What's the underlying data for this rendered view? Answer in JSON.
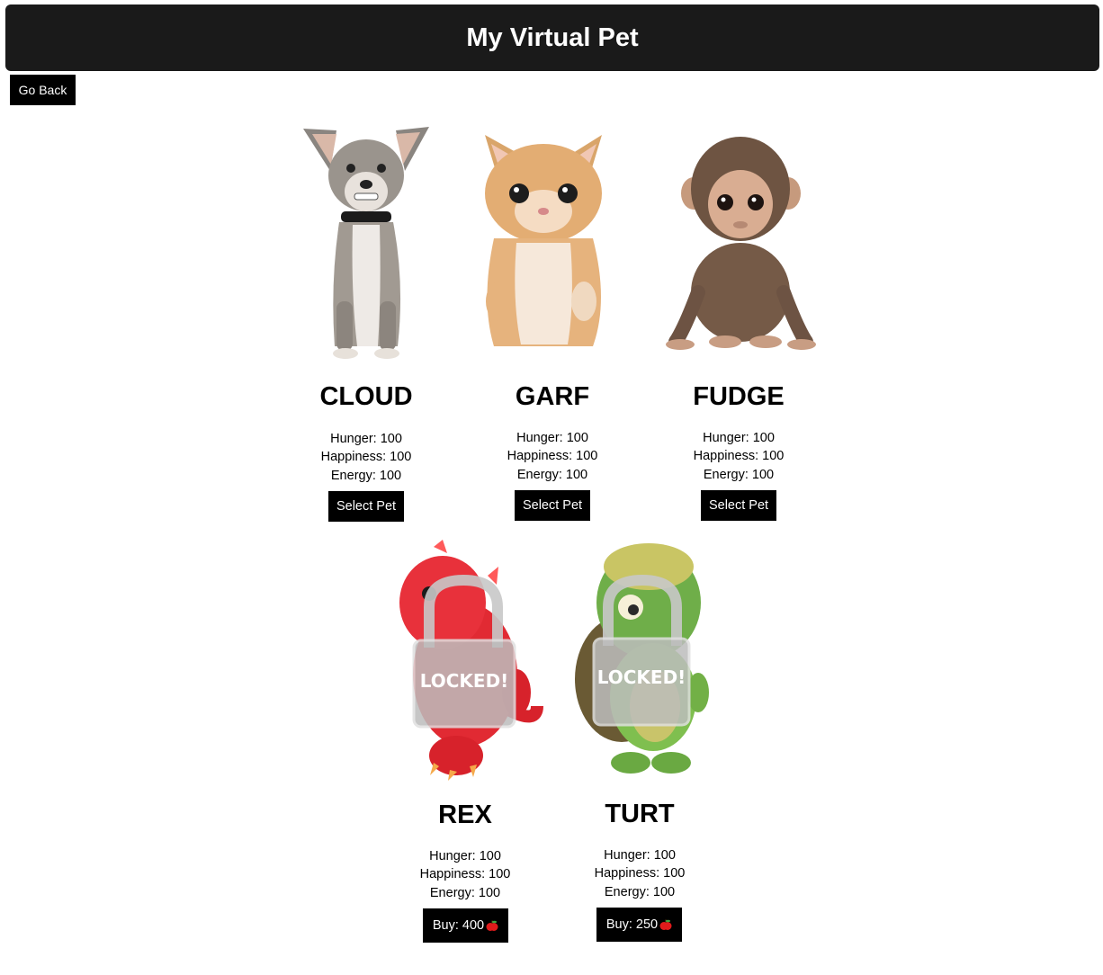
{
  "header": {
    "title": "My Virtual Pet"
  },
  "nav": {
    "go_back_label": "Go Back"
  },
  "stat_labels": {
    "hunger": "Hunger:",
    "happiness": "Happiness:",
    "energy": "Energy:"
  },
  "pets": [
    {
      "name": "CLOUD",
      "hunger": "Hunger: 100",
      "happiness": "Happiness: 100",
      "energy": "Energy: 100",
      "button": "Select Pet",
      "locked": false,
      "icon": "chihuahua-icon"
    },
    {
      "name": "GARF",
      "hunger": "Hunger: 100",
      "happiness": "Happiness: 100",
      "energy": "Energy: 100",
      "button": "Select Pet",
      "locked": false,
      "icon": "kitten-icon"
    },
    {
      "name": "FUDGE",
      "hunger": "Hunger: 100",
      "happiness": "Happiness: 100",
      "energy": "Energy: 100",
      "button": "Select Pet",
      "locked": false,
      "icon": "monkey-icon"
    },
    {
      "name": "REX",
      "hunger": "Hunger: 100",
      "happiness": "Happiness: 100",
      "energy": "Energy: 100",
      "button": "Buy: 400",
      "locked": true,
      "lock_text": "LOCKED!",
      "icon": "dinosaur-icon"
    },
    {
      "name": "TURT",
      "hunger": "Hunger: 100",
      "happiness": "Happiness: 100",
      "energy": "Energy: 100",
      "button": "Buy: 250",
      "locked": true,
      "lock_text": "LOCKED!",
      "icon": "turtle-icon"
    }
  ],
  "colors": {
    "header_bg": "#1a1a1a",
    "button_bg": "#000000",
    "button_text": "#ffffff",
    "apple": "#e01b1b"
  }
}
